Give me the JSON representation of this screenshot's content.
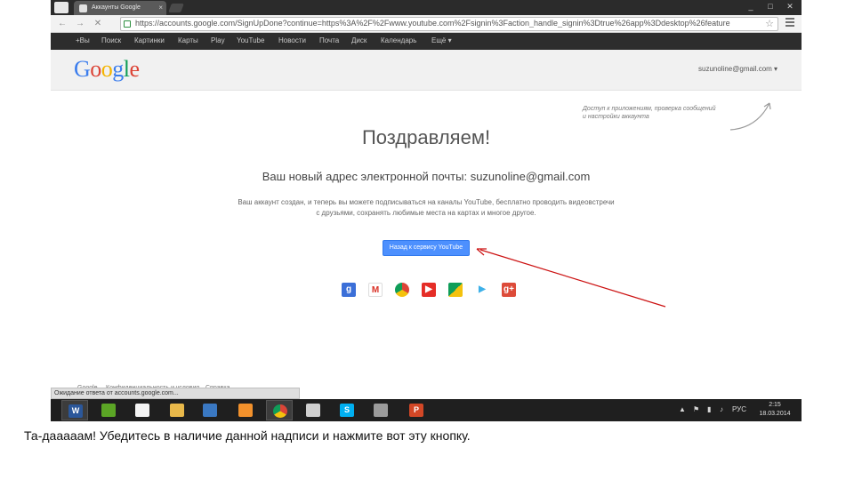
{
  "browser": {
    "tab_title": "Аккаунты Google",
    "tab_close": "×",
    "win_minimize": "_",
    "win_maximize": "□",
    "win_close": "✕",
    "url": "https://accounts.google.com/SignUpDone?continue=https%3A%2F%2Fwww.youtube.com%2Fsignin%3Faction_handle_signin%3Dtrue%26app%3Ddesktop%26feature",
    "back": "←",
    "forward": "→",
    "stop": "✕",
    "star": "☆"
  },
  "gbar": {
    "items": [
      "+Вы",
      "Поиск",
      "Картинки",
      "Карты",
      "Play",
      "YouTube",
      "Новости",
      "Почта",
      "Диск",
      "Календарь",
      "Ещё ▾"
    ]
  },
  "header": {
    "logo": [
      "G",
      "o",
      "o",
      "g",
      "l",
      "e"
    ],
    "account": "suzunoline@gmail.com ▾"
  },
  "main": {
    "hint": "Доступ к приложениям, проверка сообщений и настройки аккаунта",
    "title": "Поздравляем!",
    "new_address": "Ваш новый адрес электронной почты: suzunoline@gmail.com",
    "description": "Ваш аккаунт создан, и теперь вы можете подписываться на каналы YouTube, бесплатно проводить видеовстречи с друзьями, сохранять любимые места на картах и многое другое.",
    "cta": "Назад к сервису YouTube",
    "products": [
      {
        "name": "google-plus",
        "glyph": "g",
        "color": "#3b6fd8"
      },
      {
        "name": "gmail",
        "glyph": "M",
        "color": "#ffffff"
      },
      {
        "name": "chrome",
        "glyph": "",
        "color": "#ffffff"
      },
      {
        "name": "youtube",
        "glyph": "▶",
        "color": "#e52d27"
      },
      {
        "name": "maps",
        "glyph": "",
        "color": "#ffffff"
      },
      {
        "name": "play",
        "glyph": "▶",
        "color": "#ffffff"
      },
      {
        "name": "google-plus-red",
        "glyph": "g+",
        "color": "#dd4b39"
      }
    ]
  },
  "footer": {
    "links": [
      "Google",
      "Конфиденциальность и условия",
      "Справка"
    ],
    "status": "Ожидание ответа от accounts.google.com..."
  },
  "taskbar": {
    "items": [
      {
        "name": "word",
        "glyph": "W",
        "color": "#2b579a",
        "active": true
      },
      {
        "name": "evernote",
        "glyph": "",
        "color": "#5ba525",
        "active": false
      },
      {
        "name": "apps",
        "glyph": "",
        "color": "#f3f3f3",
        "active": false
      },
      {
        "name": "explorer",
        "glyph": "",
        "color": "#e8b84a",
        "active": false
      },
      {
        "name": "app-blue",
        "glyph": "",
        "color": "#3a78c2",
        "active": false
      },
      {
        "name": "app-orange",
        "glyph": "",
        "color": "#f2912c",
        "active": false
      },
      {
        "name": "chrome",
        "glyph": "",
        "color": "#ffffff",
        "active": true
      },
      {
        "name": "app-dark",
        "glyph": "",
        "color": "#cfcfcf",
        "active": false
      },
      {
        "name": "skype",
        "glyph": "S",
        "color": "#00aff0",
        "active": false
      },
      {
        "name": "tank",
        "glyph": "",
        "color": "#9b9b9b",
        "active": false
      },
      {
        "name": "powerpoint",
        "glyph": "P",
        "color": "#d24726",
        "active": false
      }
    ],
    "lang": "РУС",
    "time": "2:15",
    "date": "18.03.2014"
  },
  "annotation": {
    "caption": "Та-дааааам! Убедитесь в наличие данной надписи и нажмите вот эту кнопку.",
    "arrow_color": "#cc1111"
  }
}
